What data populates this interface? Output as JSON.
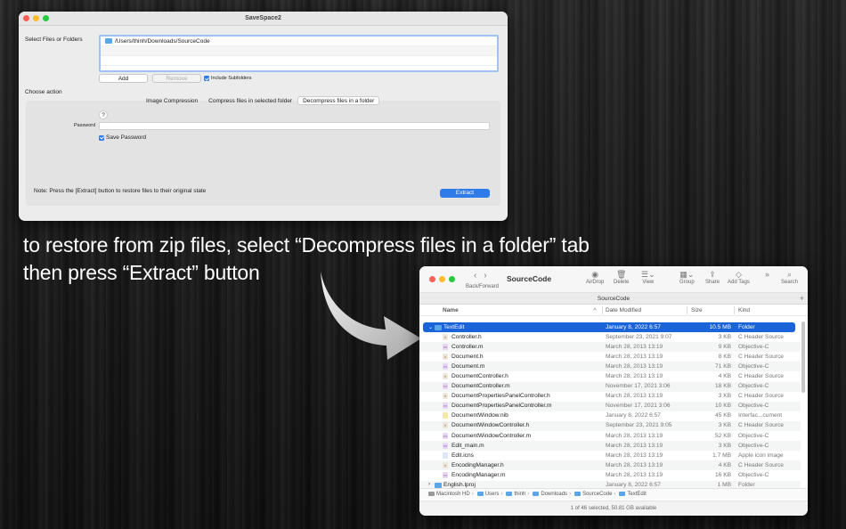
{
  "savespace": {
    "title": "SaveSpace2",
    "select_label": "Select Files or Folders",
    "selected_path": "/Users/thinh/Downloads/SourceCode",
    "add_label": "Add",
    "remove_label": "Remove",
    "include_subfolders_label": "Include Subfolders",
    "include_subfolders_checked": true,
    "choose_action_label": "Choose action",
    "tabs": [
      "Image Compression",
      "Compress files in selected folder",
      "Decompress files in a folder"
    ],
    "active_tab": "Decompress files in a folder",
    "help_label": "?",
    "password_label": "Password",
    "password_value": "",
    "save_password_label": "Save Password",
    "save_password_checked": true,
    "note": "Note: Press the [Extract] button to restore files to their original state",
    "extract_label": "Extract"
  },
  "caption": {
    "line1": "to restore from zip files, select “Decompress files in a folder” tab",
    "line2": "then press “Extract” button"
  },
  "finder": {
    "title": "SourceCode",
    "back_forward_label": "Back/Forward",
    "toolbar": [
      {
        "icon": "airdrop-icon",
        "label": "AirDrop"
      },
      {
        "icon": "trash-icon",
        "label": "Delete"
      },
      {
        "icon": "list-view-icon",
        "label": "View"
      },
      {
        "icon": "group-icon",
        "label": "Group"
      },
      {
        "icon": "share-icon",
        "label": "Share"
      },
      {
        "icon": "tag-icon",
        "label": "Add Tags"
      },
      {
        "icon": "search-icon",
        "label": "Search"
      }
    ],
    "tab_title": "SourceCode",
    "columns": {
      "name": "Name",
      "date": "Date Modified",
      "size": "Size",
      "kind": "Kind"
    },
    "rows": [
      {
        "name": "TextEdit",
        "date": "January 8, 2022 6:57",
        "size": "10.5 MB",
        "kind": "Folder",
        "type": "folder",
        "selected": true
      },
      {
        "name": "Controller.h",
        "date": "September 23, 2021 9:07",
        "size": "3 KB",
        "kind": "C Header Source",
        "type": "h"
      },
      {
        "name": "Controller.m",
        "date": "March 28, 2013 13:19",
        "size": "9 KB",
        "kind": "Objective-C",
        "type": "m"
      },
      {
        "name": "Document.h",
        "date": "March 28, 2013 13:19",
        "size": "8 KB",
        "kind": "C Header Source",
        "type": "h"
      },
      {
        "name": "Document.m",
        "date": "March 28, 2013 13:19",
        "size": "71 KB",
        "kind": "Objective-C",
        "type": "m"
      },
      {
        "name": "DocumentController.h",
        "date": "March 28, 2013 13:19",
        "size": "4 KB",
        "kind": "C Header Source",
        "type": "h"
      },
      {
        "name": "DocumentController.m",
        "date": "November 17, 2021 3:06",
        "size": "18 KB",
        "kind": "Objective-C",
        "type": "m"
      },
      {
        "name": "DocumentPropertiesPanelController.h",
        "date": "March 28, 2013 13:19",
        "size": "3 KB",
        "kind": "C Header Source",
        "type": "h"
      },
      {
        "name": "DocumentPropertiesPanelController.m",
        "date": "November 17, 2021 3:06",
        "size": "10 KB",
        "kind": "Objective-C",
        "type": "m"
      },
      {
        "name": "DocumentWindow.nib",
        "date": "January 8, 2022 6:57",
        "size": "45 KB",
        "kind": "Interfac...cument",
        "type": "nib"
      },
      {
        "name": "DocumentWindowController.h",
        "date": "September 23, 2021 9:05",
        "size": "3 KB",
        "kind": "C Header Source",
        "type": "h"
      },
      {
        "name": "DocumentWindowController.m",
        "date": "March 28, 2013 13:19",
        "size": "52 KB",
        "kind": "Objective-C",
        "type": "m"
      },
      {
        "name": "Edit_main.m",
        "date": "March 28, 2013 13:19",
        "size": "3 KB",
        "kind": "Objective-C",
        "type": "m"
      },
      {
        "name": "Edit.icns",
        "date": "March 28, 2013 13:19",
        "size": "1.7 MB",
        "kind": "Apple icon image",
        "type": "icns"
      },
      {
        "name": "EncodingManager.h",
        "date": "March 28, 2013 13:19",
        "size": "4 KB",
        "kind": "C Header Source",
        "type": "h"
      },
      {
        "name": "EncodingManager.m",
        "date": "March 28, 2013 13:19",
        "size": "16 KB",
        "kind": "Objective-C",
        "type": "m"
      },
      {
        "name": "English.lproj",
        "date": "January 8, 2022 6:57",
        "size": "1 MB",
        "kind": "Folder",
        "type": "folder",
        "collapsed": true
      }
    ],
    "path": [
      "Macintosh HD",
      "Users",
      "thinh",
      "Downloads",
      "SourceCode",
      "TextEdit"
    ],
    "status": "1 of 46 selected, 50.81 GB available"
  }
}
